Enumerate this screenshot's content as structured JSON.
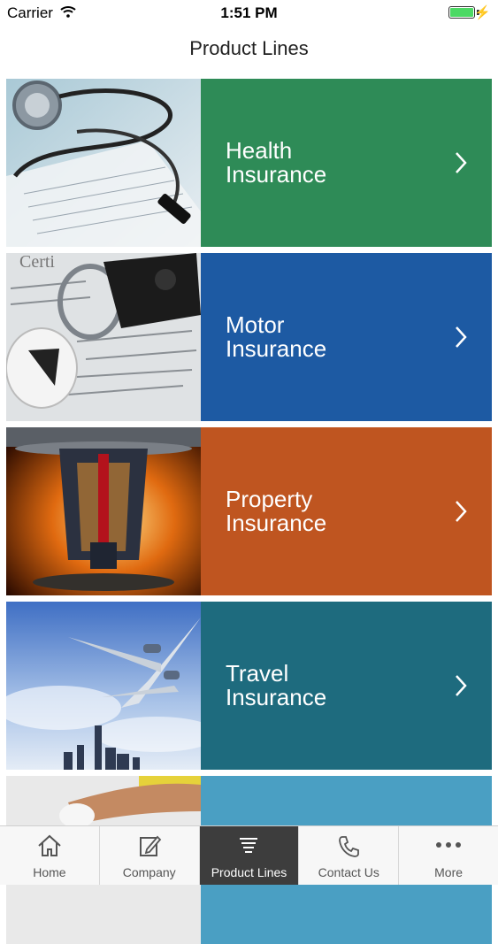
{
  "status_bar": {
    "carrier": "Carrier",
    "time": "1:51 PM"
  },
  "header": {
    "title": "Product Lines"
  },
  "products": [
    {
      "label": "Health\nInsurance",
      "color": "#2e8b57",
      "icon": "stethoscope-photo"
    },
    {
      "label": "Motor\nInsurance",
      "color": "#1d5aa3",
      "icon": "car-keys-photo"
    },
    {
      "label": "Property\nInsurance",
      "color": "#bf5520",
      "icon": "sprinkler-photo"
    },
    {
      "label": "Travel\nInsurance",
      "color": "#1e6b7e",
      "icon": "airplane-photo"
    },
    {
      "label": "",
      "color": "#4a9fc3",
      "icon": "hands-photo"
    }
  ],
  "tab_bar": {
    "tabs": [
      {
        "label": "Home",
        "icon": "home-icon"
      },
      {
        "label": "Company",
        "icon": "edit-icon"
      },
      {
        "label": "Product Lines",
        "icon": "list-icon",
        "active": true
      },
      {
        "label": "Contact Us",
        "icon": "phone-icon"
      },
      {
        "label": "More",
        "icon": "more-icon"
      }
    ]
  }
}
